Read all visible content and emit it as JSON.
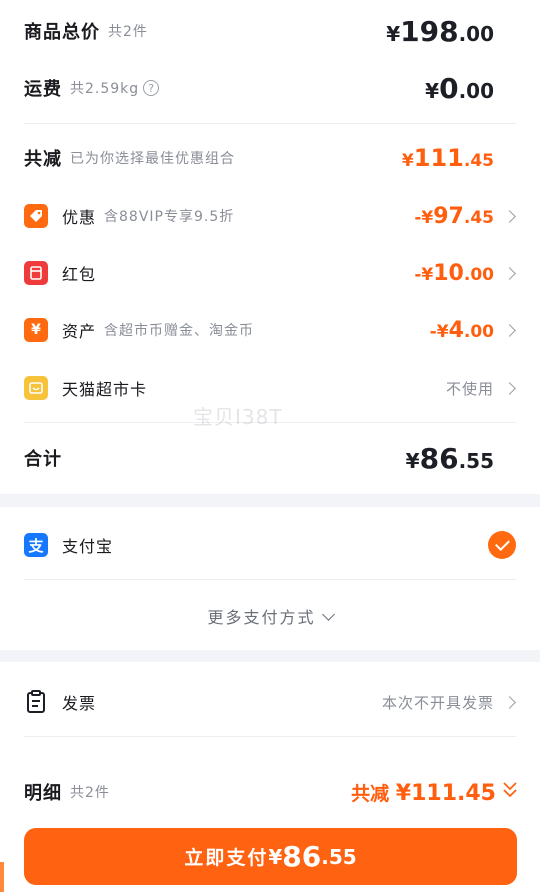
{
  "summary": {
    "total": {
      "label": "商品总价",
      "sub": "共2件",
      "currency": "¥",
      "int": "198",
      "dec": ".00"
    },
    "shipping": {
      "label": "运费",
      "sub": "共2.59kg",
      "help_icon": "?",
      "currency": "¥",
      "int": "0",
      "dec": ".00"
    },
    "discount": {
      "label": "共减",
      "sub": "已为你选择最佳优惠组合",
      "currency": "¥",
      "int": "111",
      "dec": ".45"
    }
  },
  "items": [
    {
      "icon": "tag-icon",
      "icon_color": "#ff6a10",
      "label": "优惠",
      "sub": "含88VIP专享9.5折",
      "prefix": "-¥",
      "int": "97",
      "dec": ".45"
    },
    {
      "icon": "red-packet-icon",
      "icon_color": "#ef3b3b",
      "label": "红包",
      "sub": "",
      "prefix": "-¥",
      "int": "10",
      "dec": ".00"
    },
    {
      "icon": "yen-icon",
      "icon_color": "#ff6a10",
      "label": "资产",
      "sub": "含超市币赠金、淘金币",
      "prefix": "-¥",
      "int": "4",
      "dec": ".00"
    },
    {
      "icon": "card-icon",
      "icon_color": "#f7c33a",
      "label": "天猫超市卡",
      "sub": "",
      "status": "不使用"
    }
  ],
  "grand_total": {
    "label": "合计",
    "currency": "¥",
    "int": "86",
    "dec": ".55"
  },
  "payment": {
    "method": "支付宝",
    "icon_char": "支",
    "icon_color": "#1677ff",
    "selected": true,
    "more": "更多支付方式"
  },
  "invoice": {
    "label": "发票",
    "value": "本次不开具发票"
  },
  "detail": {
    "label": "明细",
    "sub": "共2件",
    "prefix": "共减",
    "currency": "¥",
    "amount": "111.45"
  },
  "pay_button": {
    "label": "立即支付",
    "currency": "¥",
    "int": "86",
    "dec": ".55"
  },
  "watermark": "宝贝I38T",
  "colors": {
    "accent": "#ff6210",
    "text": "#1d1f27",
    "muted": "#8a8e97"
  }
}
